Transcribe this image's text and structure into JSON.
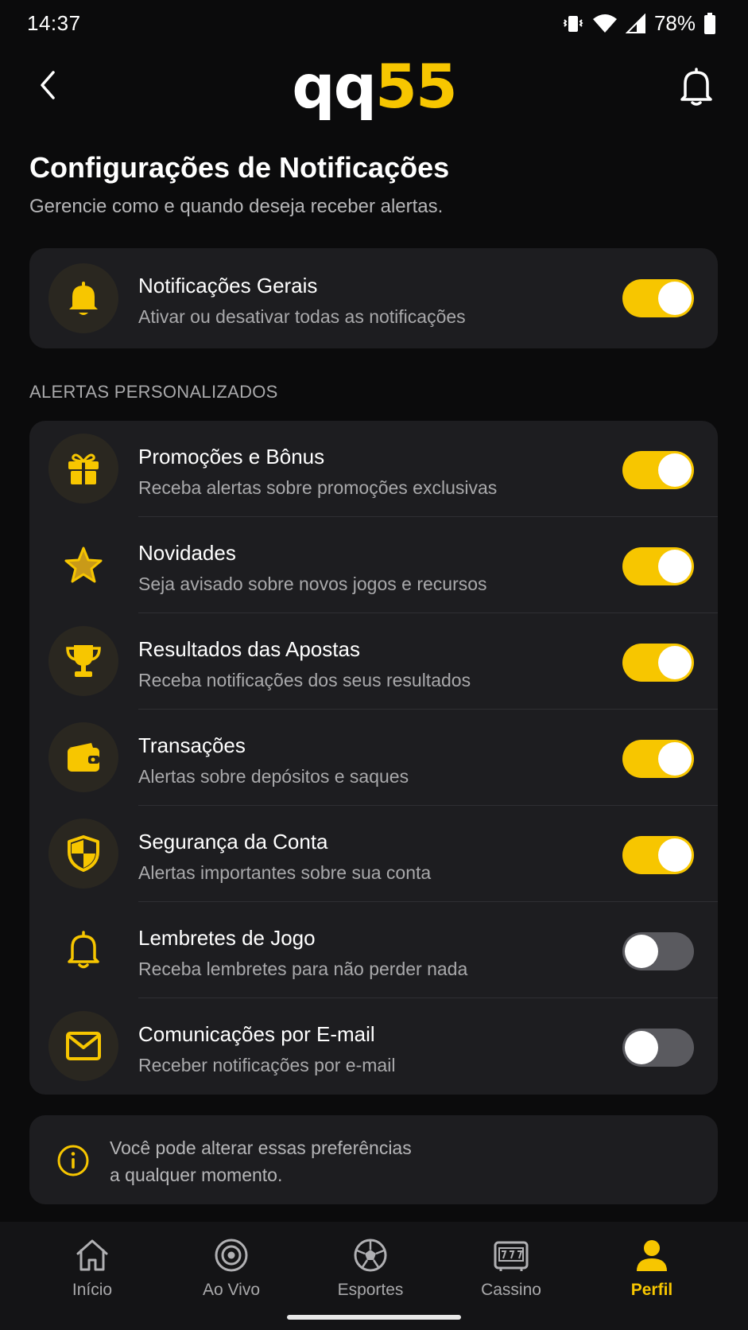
{
  "status_bar": {
    "time": "14:37",
    "battery": "78%"
  },
  "header": {
    "logo_part1": "qq",
    "logo_part2": "55"
  },
  "page": {
    "title": "Configurações de Notificações",
    "subtitle": "Gerencie como e quando deseja receber alertas."
  },
  "general": {
    "title": "Notificações Gerais",
    "description": "Ativar ou desativar todas as notificações",
    "enabled": true,
    "icon": "bell-icon"
  },
  "section_label": "ALERTAS PERSONALIZADOS",
  "alerts": [
    {
      "title": "Promoções e Bônus",
      "description": "Receba alertas sobre promoções exclusivas",
      "enabled": true,
      "icon": "gift-icon"
    },
    {
      "title": "Novidades",
      "description": "Seja avisado sobre novos jogos e recursos",
      "enabled": true,
      "icon": "star-icon"
    },
    {
      "title": "Resultados das Apostas",
      "description": "Receba notificações dos seus resultados",
      "enabled": true,
      "icon": "trophy-icon"
    },
    {
      "title": "Transações",
      "description": "Alertas sobre depósitos e saques",
      "enabled": true,
      "icon": "wallet-icon"
    },
    {
      "title": "Segurança da Conta",
      "description": "Alertas importantes sobre sua conta",
      "enabled": true,
      "icon": "shield-icon"
    },
    {
      "title": "Lembretes de Jogo",
      "description": "Receba lembretes para não perder nada",
      "enabled": false,
      "icon": "bell-icon"
    },
    {
      "title": "Comunicações por E-mail",
      "description": "Receber notificações por e-mail",
      "enabled": false,
      "icon": "mail-icon"
    }
  ],
  "info": {
    "line1": "Você pode alterar essas preferências",
    "line2": "a qualquer momento."
  },
  "nav": [
    {
      "label": "Início",
      "icon": "home-icon",
      "active": false
    },
    {
      "label": "Ao Vivo",
      "icon": "live-icon",
      "active": false
    },
    {
      "label": "Esportes",
      "icon": "soccer-ball-icon",
      "active": false
    },
    {
      "label": "Cassino",
      "icon": "slot-machine-icon",
      "active": false
    },
    {
      "label": "Perfil",
      "icon": "user-icon",
      "active": true
    }
  ],
  "colors": {
    "accent": "#f7c600",
    "background": "#0b0b0c",
    "card": "#1d1d20",
    "toggle_off": "#5a5a5f"
  }
}
